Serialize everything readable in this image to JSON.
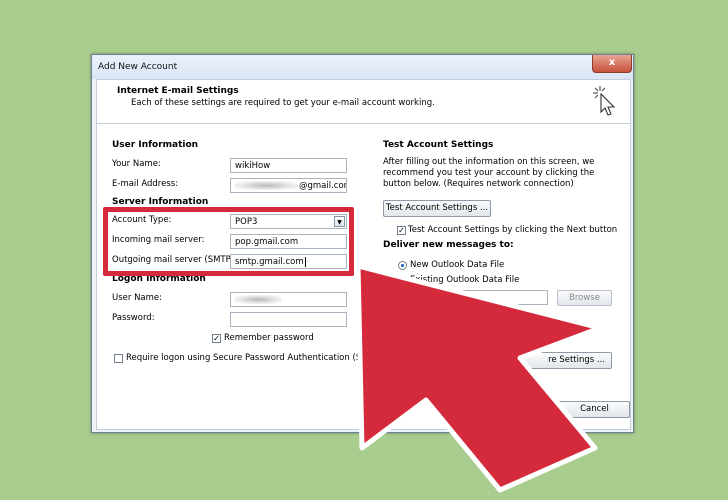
{
  "window": {
    "title": "Add New Account",
    "close": "x"
  },
  "header": {
    "title": "Internet E-mail Settings",
    "subtitle": "Each of these settings are required to get your e-mail account working."
  },
  "user_info": {
    "heading": "User Information",
    "name_label": "Your Name:",
    "name_value": "wikiHow",
    "email_label": "E-mail Address:",
    "email_value": "@gmail.com"
  },
  "server_info": {
    "heading": "Server Information",
    "account_type_label": "Account Type:",
    "account_type_value": "POP3",
    "incoming_label": "Incoming mail server:",
    "incoming_value": "pop.gmail.com",
    "outgoing_label": "Outgoing mail server (SMTP):",
    "outgoing_value": "smtp.gmail.com"
  },
  "logon_info": {
    "heading": "Logon Information",
    "username_label": "User Name:",
    "password_label": "Password:",
    "remember_label": "Remember password",
    "spa_label": "Require logon using Secure Password Authentication (SPA)"
  },
  "test_settings": {
    "heading": "Test Account Settings",
    "description": "After filling out the information on this screen, we recommend you test your account by clicking the button below. (Requires network connection)",
    "test_button": "Test Account Settings ...",
    "auto_test_label": "Test Account Settings by clicking the Next button"
  },
  "deliver": {
    "heading": "Deliver new messages to:",
    "new_file_label": "New Outlook Data File",
    "existing_file_label": "Existing Outlook Data File",
    "browse_button": "Browse"
  },
  "footer": {
    "more_settings_button": "re Settings ...",
    "cancel_button": "Cancel"
  },
  "colors": {
    "highlight": "#d52a3c",
    "arrow": "#d52a3c",
    "background": "#a9cc8f"
  }
}
